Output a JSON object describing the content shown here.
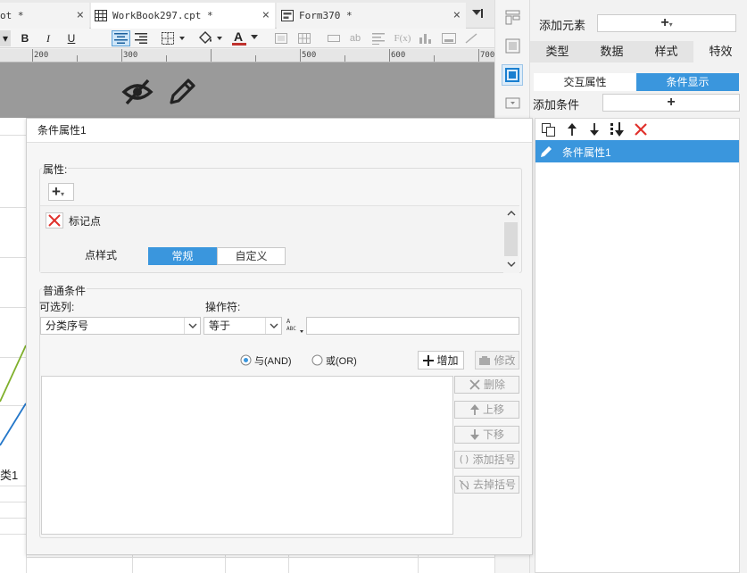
{
  "tabs": [
    {
      "label": "ot *",
      "close": "×"
    },
    {
      "label": "WorkBook297.cpt *",
      "close": "×"
    },
    {
      "label": "Form370 *",
      "close": "×"
    }
  ],
  "toolbar": {
    "bold": "B",
    "italic": "I",
    "underline": "U",
    "font_color": "A",
    "text_ab": "ab",
    "formula": "F(x)"
  },
  "ruler": {
    "ticks": [
      "200",
      "300",
      "500",
      "600",
      "700"
    ]
  },
  "sheet_label": "类1",
  "right_panel": {
    "add_element_label": "添加元素",
    "add_element_value": "+",
    "tabs": [
      "类型",
      "数据",
      "样式",
      "特效"
    ],
    "active_tab_index": 3,
    "subtabs": [
      "交互属性",
      "条件显示"
    ],
    "active_subtab_index": 1,
    "add_condition_label": "添加条件",
    "add_condition_value": "+",
    "condition_items": [
      "条件属性1"
    ]
  },
  "dialog": {
    "title": "条件属性1",
    "property_section": {
      "label": "属性:",
      "add_button": "+",
      "item_name": "标记点",
      "point_style_label": "点样式",
      "style_options": [
        "常规",
        "自定义"
      ],
      "selected_style": "常规"
    },
    "condition_section": {
      "label": "普通条件",
      "column_label": "可选列:",
      "column_value": "分类序号",
      "operator_label": "操作符:",
      "operator_value": "等于",
      "value_input": "",
      "radio_and": "与(AND)",
      "radio_or": "或(OR)",
      "selected_radio": "AND",
      "add_button": "增加",
      "modify_button": "修改",
      "delete_button": "删除",
      "up_button": "上移",
      "down_button": "下移",
      "add_bracket_button": "添加括号",
      "remove_bracket_button": "去掉括号"
    }
  },
  "colors": {
    "accent": "#3a96dd",
    "delete_red": "#e0312c",
    "canvas_gray": "#9a9a9a"
  }
}
